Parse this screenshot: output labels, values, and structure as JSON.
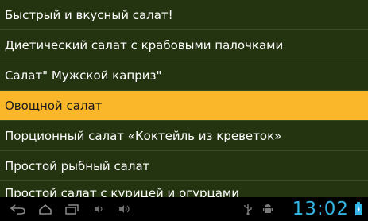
{
  "list": {
    "items": [
      {
        "label": "Быстрый и вкусный салат!"
      },
      {
        "label": "Диетический салат с крабовыми палочками"
      },
      {
        "label": "Салат\" Мужской каприз\""
      },
      {
        "label": "Овощной салат",
        "selected": true
      },
      {
        "label": "Порционный салат «Коктейль из креветок»"
      },
      {
        "label": "Простой рыбный салат"
      },
      {
        "label": "Простой салат с курицей и огурцами"
      }
    ]
  },
  "status_bar": {
    "time": "13:02"
  },
  "colors": {
    "background": "#243310",
    "selected": "#fbb72a",
    "clock": "#33b5e5"
  },
  "icons": [
    "back-icon",
    "home-icon",
    "recent-apps-icon",
    "volume-down-icon",
    "volume-up-icon",
    "usb-icon",
    "android-debug-icon",
    "battery-icon"
  ]
}
